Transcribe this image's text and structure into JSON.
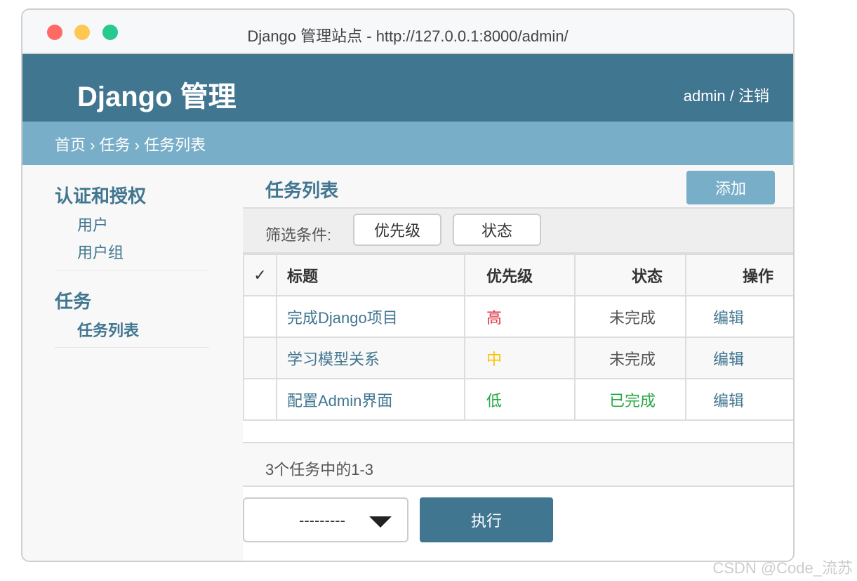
{
  "window": {
    "title": "Django 管理站点 - http://127.0.0.1:8000/admin/"
  },
  "header": {
    "brand": "Django 管理",
    "user_links": "admin / 注销"
  },
  "breadcrumb": "首页 › 任务 › 任务列表",
  "sidebar": {
    "modules": [
      {
        "title": "认证和授权",
        "items": [
          "用户",
          "用户组"
        ]
      },
      {
        "title": "任务",
        "items": [
          "任务列表"
        ]
      }
    ]
  },
  "content": {
    "title": "任务列表",
    "add_button": "添加",
    "filter": {
      "label": "筛选条件:",
      "options": [
        "优先级",
        "状态"
      ]
    },
    "table": {
      "check_header": "✓",
      "columns": [
        "标题",
        "优先级",
        "状态",
        "操作"
      ],
      "rows": [
        {
          "title": "完成Django项目",
          "priority": "高",
          "status": "未完成",
          "action": "编辑"
        },
        {
          "title": "学习模型关系",
          "priority": "中",
          "status": "未完成",
          "action": "编辑"
        },
        {
          "title": "配置Admin界面",
          "priority": "低",
          "status": "已完成",
          "action": "编辑"
        }
      ]
    },
    "paginator": "3个任务中的1-3",
    "action_select": "---------",
    "run_button": "执行"
  },
  "watermark": "CSDN @Code_流苏",
  "colors": {
    "header": "#417690",
    "breadcrumb": "#79aec8",
    "priority_high": "#dc3545",
    "priority_mid": "#ffc107",
    "priority_low": "#28a745",
    "status_done": "#28a745"
  }
}
